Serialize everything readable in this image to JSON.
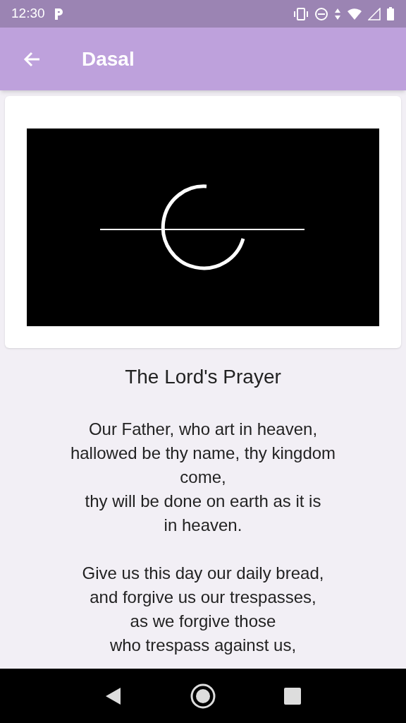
{
  "status_bar": {
    "time": "12:30"
  },
  "app_bar": {
    "title": "Dasal"
  },
  "prayer": {
    "title": "The Lord's Prayer",
    "stanzas": [
      [
        "Our Father, who art in heaven,",
        "hallowed be thy name, thy kingdom",
        "come,",
        "thy will be done on earth as it is",
        "in heaven."
      ],
      [
        "Give us this day our daily bread,",
        "and forgive us our trespasses,",
        "as we forgive those",
        "who trespass against us,"
      ]
    ]
  }
}
